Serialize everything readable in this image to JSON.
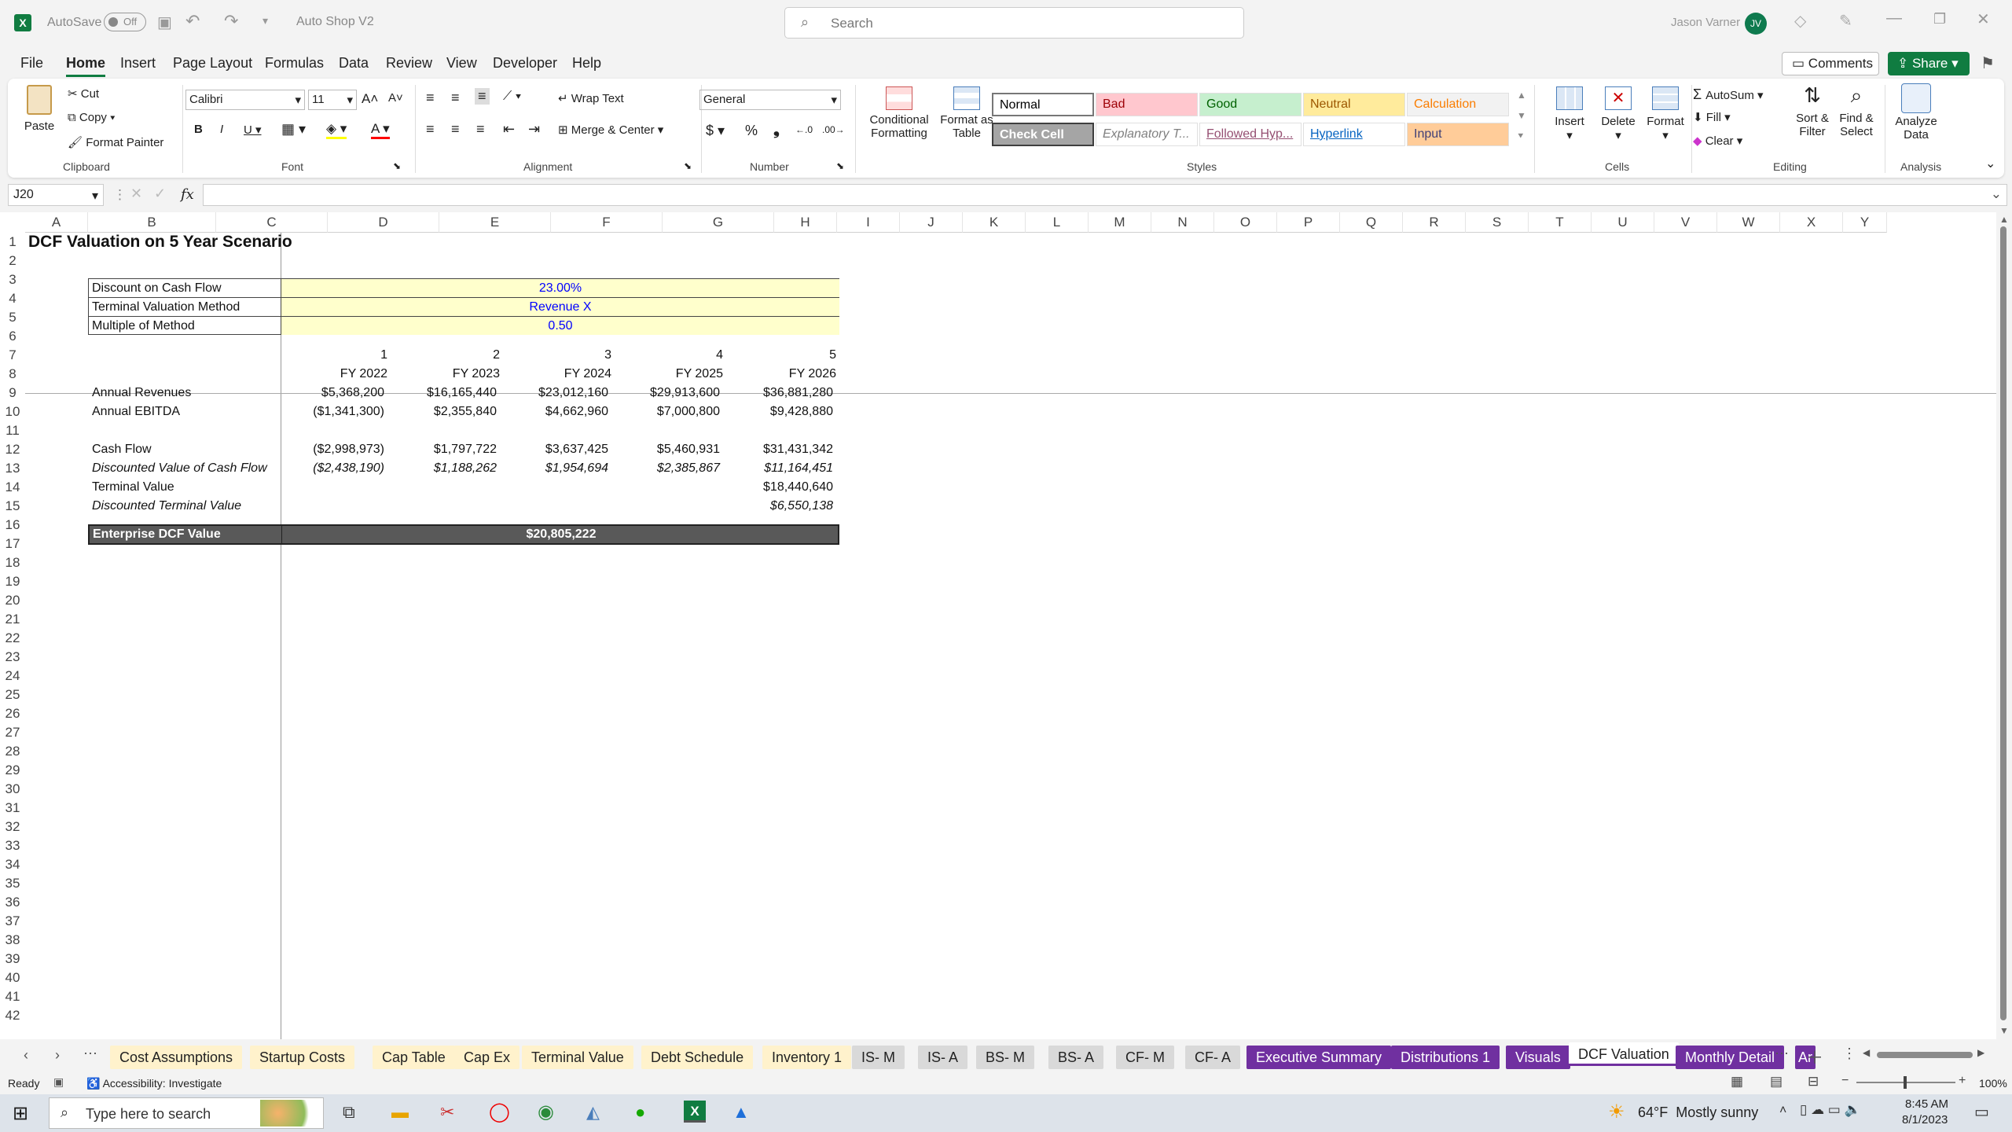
{
  "titlebar": {
    "autosave": "AutoSave",
    "toggle": "Off",
    "filename": "Auto Shop V2",
    "search_placeholder": "Search",
    "user": "Jason Varner",
    "initials": "JV"
  },
  "menu": [
    "File",
    "Home",
    "Insert",
    "Page Layout",
    "Formulas",
    "Data",
    "Review",
    "View",
    "Developer",
    "Help"
  ],
  "actions": {
    "comments": "Comments",
    "share": "Share"
  },
  "ribbon": {
    "clipboard": {
      "paste": "Paste",
      "cut": "Cut",
      "copy": "Copy",
      "format_painter": "Format Painter",
      "group": "Clipboard"
    },
    "font": {
      "name": "Calibri",
      "size": "11",
      "group": "Font"
    },
    "alignment": {
      "wrap": "Wrap Text",
      "merge": "Merge & Center",
      "group": "Alignment"
    },
    "number": {
      "format": "General",
      "group": "Number"
    },
    "styles": {
      "cond": "Conditional Formatting",
      "table": "Format as Table",
      "group": "Styles",
      "cells": [
        {
          "label": "Normal",
          "bg": "#ffffff",
          "fg": "#000000"
        },
        {
          "label": "Bad",
          "bg": "#ffc7ce",
          "fg": "#9c0006"
        },
        {
          "label": "Good",
          "bg": "#c6efce",
          "fg": "#006100"
        },
        {
          "label": "Neutral",
          "bg": "#ffeb9c",
          "fg": "#9c5700"
        },
        {
          "label": "Calculation",
          "bg": "#f2f2f2",
          "fg": "#fa7d00"
        },
        {
          "label": "Check Cell",
          "bg": "#a5a5a5",
          "fg": "#ffffff"
        },
        {
          "label": "Explanatory T...",
          "bg": "#ffffff",
          "fg": "#7f7f7f"
        },
        {
          "label": "Followed Hyp...",
          "bg": "#ffffff",
          "fg": "#954f72"
        },
        {
          "label": "Hyperlink",
          "bg": "#ffffff",
          "fg": "#0563c1"
        },
        {
          "label": "Input",
          "bg": "#ffcc99",
          "fg": "#3f3f76"
        }
      ]
    },
    "cells": {
      "insert": "Insert",
      "delete": "Delete",
      "format": "Format",
      "group": "Cells"
    },
    "editing": {
      "autosum": "AutoSum",
      "fill": "Fill",
      "clear": "Clear",
      "sort": "Sort & Filter",
      "find": "Find & Select",
      "group": "Editing"
    },
    "analysis": {
      "analyze": "Analyze Data",
      "group": "Analysis"
    }
  },
  "formula_bar": {
    "name_box": "J20",
    "fx": "fx",
    "value": ""
  },
  "columns": [
    "A",
    "B",
    "C",
    "D",
    "E",
    "F",
    "G",
    "H",
    "I",
    "J",
    "K",
    "L",
    "M",
    "N",
    "O",
    "P",
    "Q",
    "R",
    "S",
    "T",
    "U",
    "V",
    "W",
    "X",
    "Y"
  ],
  "rows": [
    "1",
    "2",
    "3",
    "4",
    "5",
    "6",
    "7",
    "8",
    "9",
    "10",
    "11",
    "12",
    "13",
    "14",
    "15",
    "16",
    "17",
    "18",
    "19",
    "20",
    "21",
    "22",
    "23",
    "24",
    "25",
    "26",
    "27",
    "28",
    "29",
    "30",
    "31",
    "32",
    "33",
    "34",
    "35",
    "36",
    "37",
    "38",
    "39",
    "40",
    "41",
    "42"
  ],
  "sheet": {
    "title": "DCF Valuation on 5 Year Scenario",
    "inputs": [
      {
        "label": "Discount on Cash Flow",
        "value": "23.00%"
      },
      {
        "label": "Terminal Valuation Method",
        "value": "Revenue X"
      },
      {
        "label": "Multiple of Method",
        "value": "0.50"
      }
    ],
    "years": [
      "1",
      "2",
      "3",
      "4",
      "5"
    ],
    "fy": [
      "FY 2022",
      "FY 2023",
      "FY 2024",
      "FY 2025",
      "FY 2026"
    ],
    "revenues": {
      "label": "Annual Revenues",
      "values": [
        "$5,368,200",
        "$16,165,440",
        "$23,012,160",
        "$29,913,600",
        "$36,881,280"
      ]
    },
    "ebitda": {
      "label": "Annual EBITDA",
      "values": [
        "($1,341,300)",
        "$2,355,840",
        "$4,662,960",
        "$7,000,800",
        "$9,428,880"
      ]
    },
    "cash_flow": {
      "label": "Cash Flow",
      "values": [
        "($2,998,973)",
        "$1,797,722",
        "$3,637,425",
        "$5,460,931",
        "$31,431,342"
      ]
    },
    "disc_cf": {
      "label": "Discounted Value of Cash Flow",
      "values": [
        "($2,438,190)",
        "$1,188,262",
        "$1,954,694",
        "$2,385,867",
        "$11,164,451"
      ]
    },
    "terminal": {
      "label": "Terminal Value",
      "value": "$18,440,640"
    },
    "disc_terminal": {
      "label": "Discounted Terminal Value",
      "value": "$6,550,138"
    },
    "enterprise": {
      "label": "Enterprise DCF Value",
      "value": "$20,805,222"
    }
  },
  "tabs": [
    {
      "label": "Cost Assumptions",
      "bg": "#fff2cc",
      "fg": "#222"
    },
    {
      "label": "Startup Costs",
      "bg": "#fff2cc",
      "fg": "#222"
    },
    {
      "label": "Cap Table",
      "bg": "#fff2cc",
      "fg": "#222"
    },
    {
      "label": "Cap Ex",
      "bg": "#fff2cc",
      "fg": "#222"
    },
    {
      "label": "Terminal Value",
      "bg": "#fff2cc",
      "fg": "#222"
    },
    {
      "label": "Debt Schedule",
      "bg": "#fff2cc",
      "fg": "#222"
    },
    {
      "label": "Inventory 1",
      "bg": "#fff2cc",
      "fg": "#222"
    },
    {
      "label": "IS- M",
      "bg": "#d9d9d9",
      "fg": "#222"
    },
    {
      "label": "IS- A",
      "bg": "#d9d9d9",
      "fg": "#222"
    },
    {
      "label": "BS- M",
      "bg": "#d9d9d9",
      "fg": "#222"
    },
    {
      "label": "BS- A",
      "bg": "#d9d9d9",
      "fg": "#222"
    },
    {
      "label": "CF- M",
      "bg": "#d9d9d9",
      "fg": "#222"
    },
    {
      "label": "CF- A",
      "bg": "#d9d9d9",
      "fg": "#222"
    },
    {
      "label": "Executive Summary",
      "bg": "#7030a0",
      "fg": "#ffffff"
    },
    {
      "label": "Distributions 1",
      "bg": "#7030a0",
      "fg": "#ffffff"
    },
    {
      "label": "Visuals",
      "bg": "#7030a0",
      "fg": "#ffffff"
    },
    {
      "label": "DCF Valuation",
      "bg": "#e6d9f0",
      "fg": "#222"
    },
    {
      "label": "Monthly Detail",
      "bg": "#7030a0",
      "fg": "#ffffff"
    },
    {
      "label": "Ar",
      "bg": "#7030a0",
      "fg": "#ffffff"
    }
  ],
  "status": {
    "ready": "Ready",
    "accessibility": "Accessibility: Investigate",
    "zoom": "100%"
  },
  "taskbar": {
    "search": "Type here to search",
    "weather": "64°F  Mostly sunny",
    "time": "8:45 AM",
    "date": "8/1/2023"
  }
}
